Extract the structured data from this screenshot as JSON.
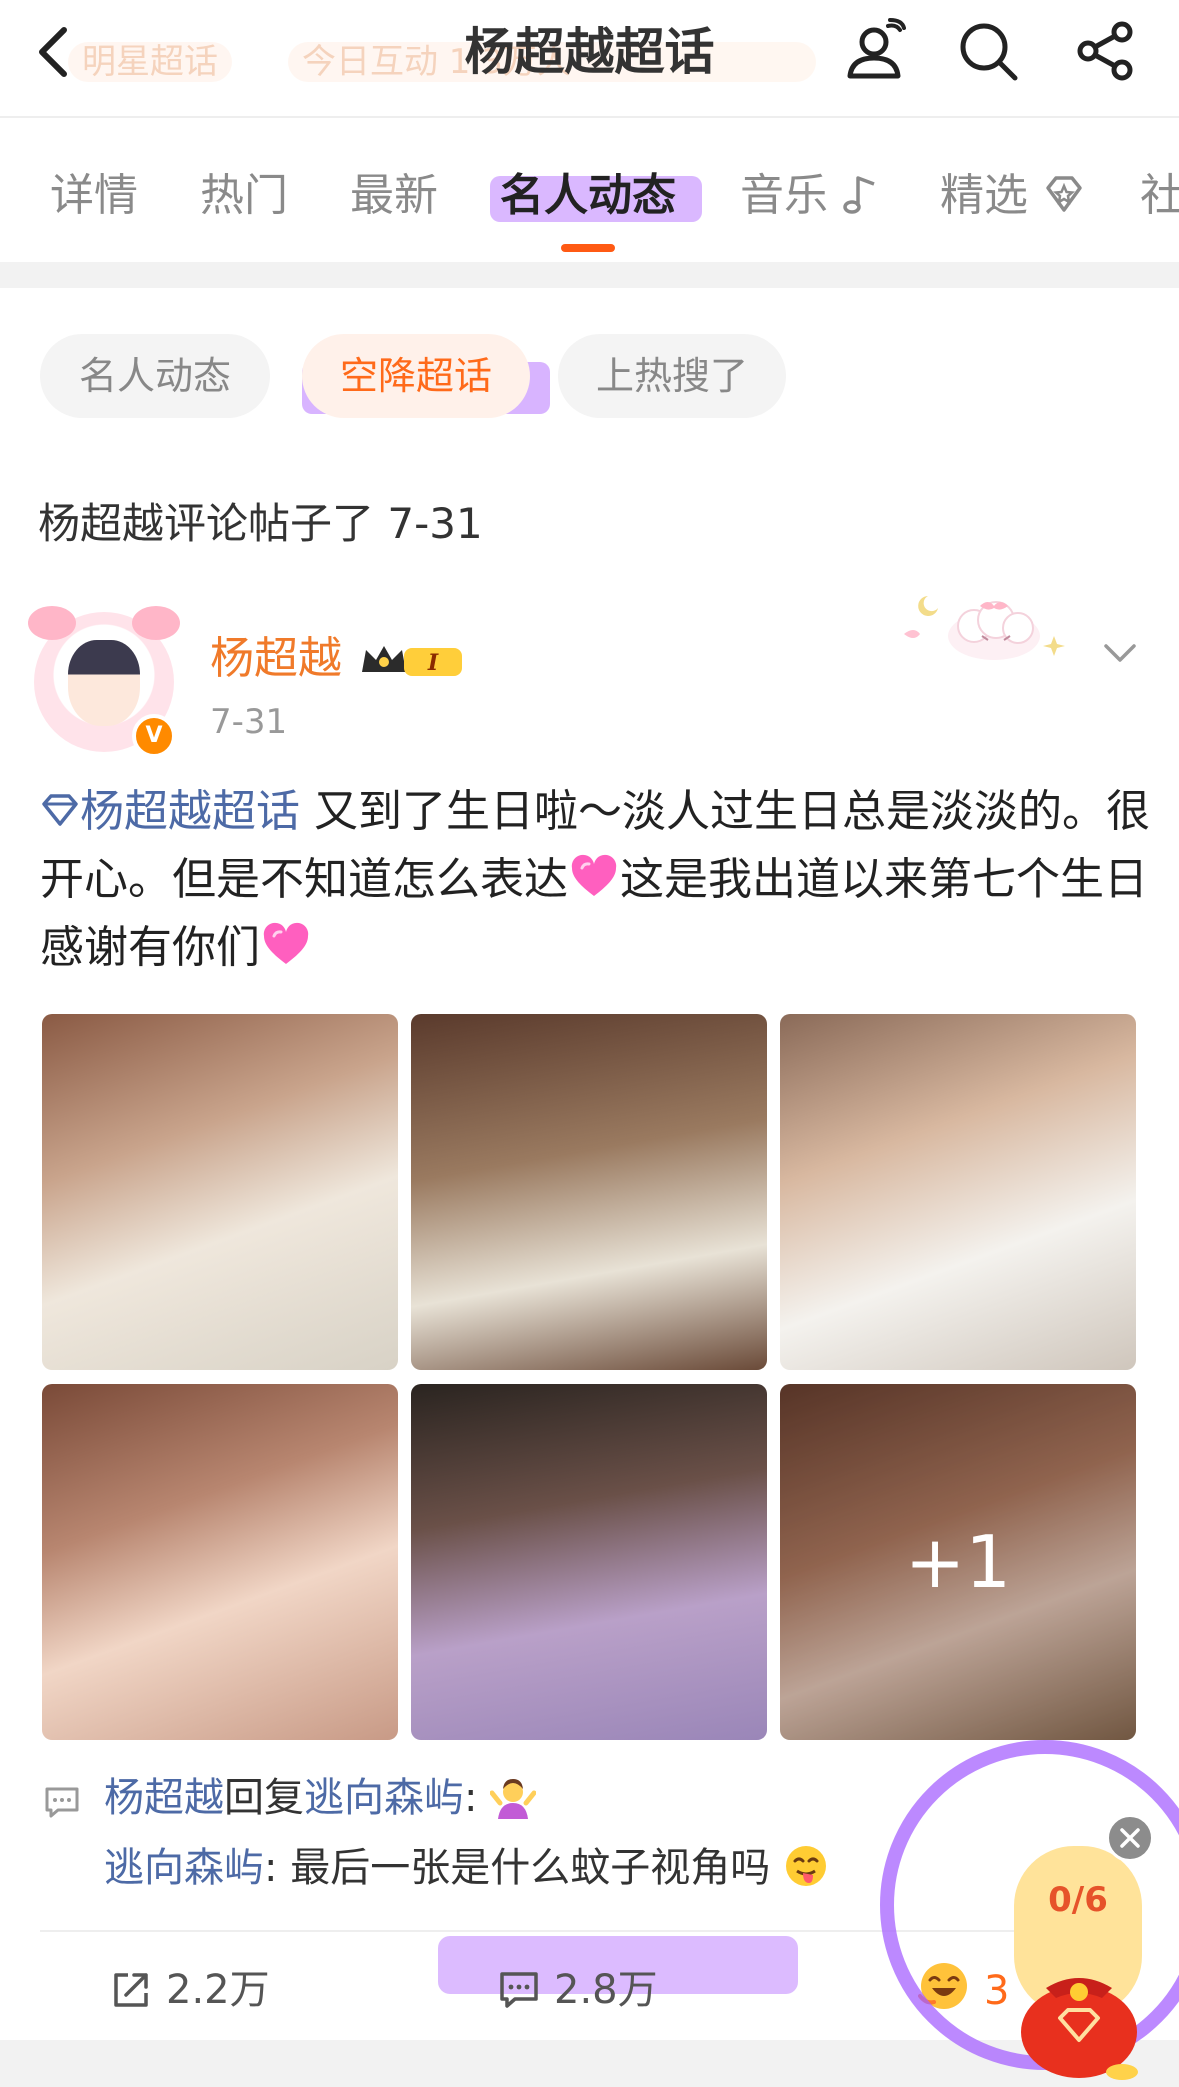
{
  "header": {
    "title": "杨超越超话",
    "ghost_left": "明星超话",
    "ghost_center": "今日互动 1.3万人"
  },
  "tabs": [
    {
      "label": "详情"
    },
    {
      "label": "热门"
    },
    {
      "label": "最新"
    },
    {
      "label": "名人动态"
    },
    {
      "label": "音乐"
    },
    {
      "label": "精选"
    },
    {
      "label": "社"
    }
  ],
  "chips": [
    "名人动态",
    "空降超话",
    "上热搜了"
  ],
  "section_title": "杨超越评论帖子了 7-31",
  "post": {
    "author": "杨超越",
    "level": "I",
    "date": "7-31",
    "topic": "杨超越超话",
    "text_part1": " 又到了生日啦～淡人过生日总是淡淡的。很开心。但是不知道怎么表达",
    "text_part2": "这是我出道以来第七个生日感谢有你们",
    "more_photos": "+1"
  },
  "comments": {
    "reply_author": "杨超越",
    "reply_verb": "回复",
    "reply_target": "逃向森屿",
    "colon": ":",
    "comment_author": "逃向森屿",
    "comment_text": " 最后一张是什么蚊子视角吗"
  },
  "actions": {
    "share_count": "2.2万",
    "comment_count": "2.8万",
    "like_count": "3"
  },
  "reward": {
    "progress": "0/6"
  },
  "colors": {
    "accent": "#ff6a1a",
    "link": "#4d6aa6",
    "highlight": "#d8b4ff",
    "username": "#f07a2a"
  }
}
